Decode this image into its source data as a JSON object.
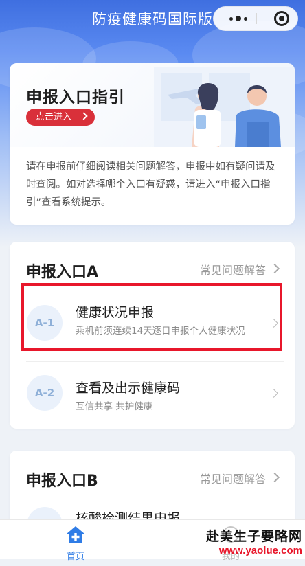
{
  "navbar": {
    "title": "防疫健康码国际版",
    "more_icon": "more-dots-icon",
    "close_icon": "capsule-close-icon"
  },
  "guide": {
    "title": "申报入口指引",
    "enter_button": "点击进入",
    "description": "请在申报前仔细阅读相关问题解答，申报中如有疑问请及时查阅。如对选择哪个入口有疑惑，请进入“申报入口指引”查看系统提示。"
  },
  "section_a": {
    "title": "申报入口A",
    "faq_label": "常见问题解答",
    "items": [
      {
        "badge": "A-1",
        "name": "健康状况申报",
        "sub": "乘机前须连续14天逐日申报个人健康状况"
      },
      {
        "badge": "A-2",
        "name": "查看及出示健康码",
        "sub": "互信共享 共护健康"
      }
    ]
  },
  "section_b": {
    "title": "申报入口B",
    "faq_label": "常见问题解答",
    "items": [
      {
        "badge": "",
        "name": "核酸检测结果申报",
        "sub": ""
      }
    ]
  },
  "highlight_color": "#e8172b",
  "tabbar": {
    "home_label": "首页",
    "mine_label": "我的",
    "active_color": "#2f7ce6"
  },
  "watermark": {
    "line1": "赴美生子要略网",
    "line2": "www.yaolue.com"
  }
}
